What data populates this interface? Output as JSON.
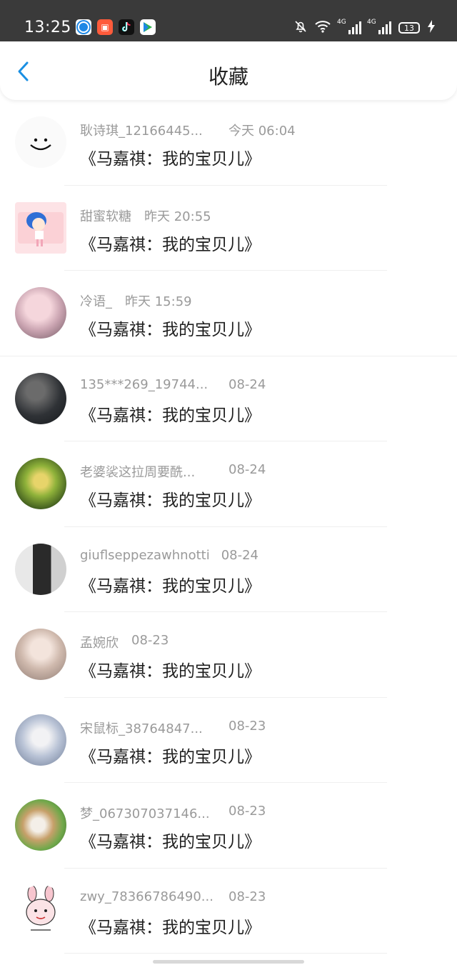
{
  "status_bar": {
    "time": "13:25",
    "signal1_label": "4G",
    "signal2_label": "4G",
    "battery": "13"
  },
  "header": {
    "title": "收藏",
    "back_icon": "chevron-left-icon"
  },
  "items": [
    {
      "user": "耿诗琪_12166445...",
      "time": "今天 06:04",
      "title": "《马嘉祺：我的宝贝儿》"
    },
    {
      "user": "甜蜜软糖",
      "time": "昨天 20:55",
      "title": "《马嘉祺：我的宝贝儿》"
    },
    {
      "user": "冷语_",
      "time": "昨天 15:59",
      "title": "《马嘉祺：我的宝贝儿》"
    },
    {
      "user": "135***269_19744...",
      "time": "08-24",
      "title": "《马嘉祺：我的宝贝儿》"
    },
    {
      "user": "老婆裟这拉周要酰...",
      "time": "08-24",
      "title": "《马嘉祺：我的宝贝儿》"
    },
    {
      "user": "giuflseppezawhnotti",
      "time": "08-24",
      "title": "《马嘉祺：我的宝贝儿》"
    },
    {
      "user": "孟婉欣",
      "time": "08-23",
      "title": "《马嘉祺：我的宝贝儿》"
    },
    {
      "user": "宋鼠标_38764847...",
      "time": "08-23",
      "title": "《马嘉祺：我的宝贝儿》"
    },
    {
      "user": "梦_067307037146...",
      "time": "08-23",
      "title": "《马嘉祺：我的宝贝儿》"
    },
    {
      "user": "zwy_78366786490...",
      "time": "08-23",
      "title": "《马嘉祺：我的宝贝儿》"
    }
  ],
  "colors": {
    "accent": "#1a8fe3",
    "status_bar_bg": "#3a3a3a",
    "meta_text": "#9a9a9a",
    "title_text": "#1f1f1f"
  }
}
